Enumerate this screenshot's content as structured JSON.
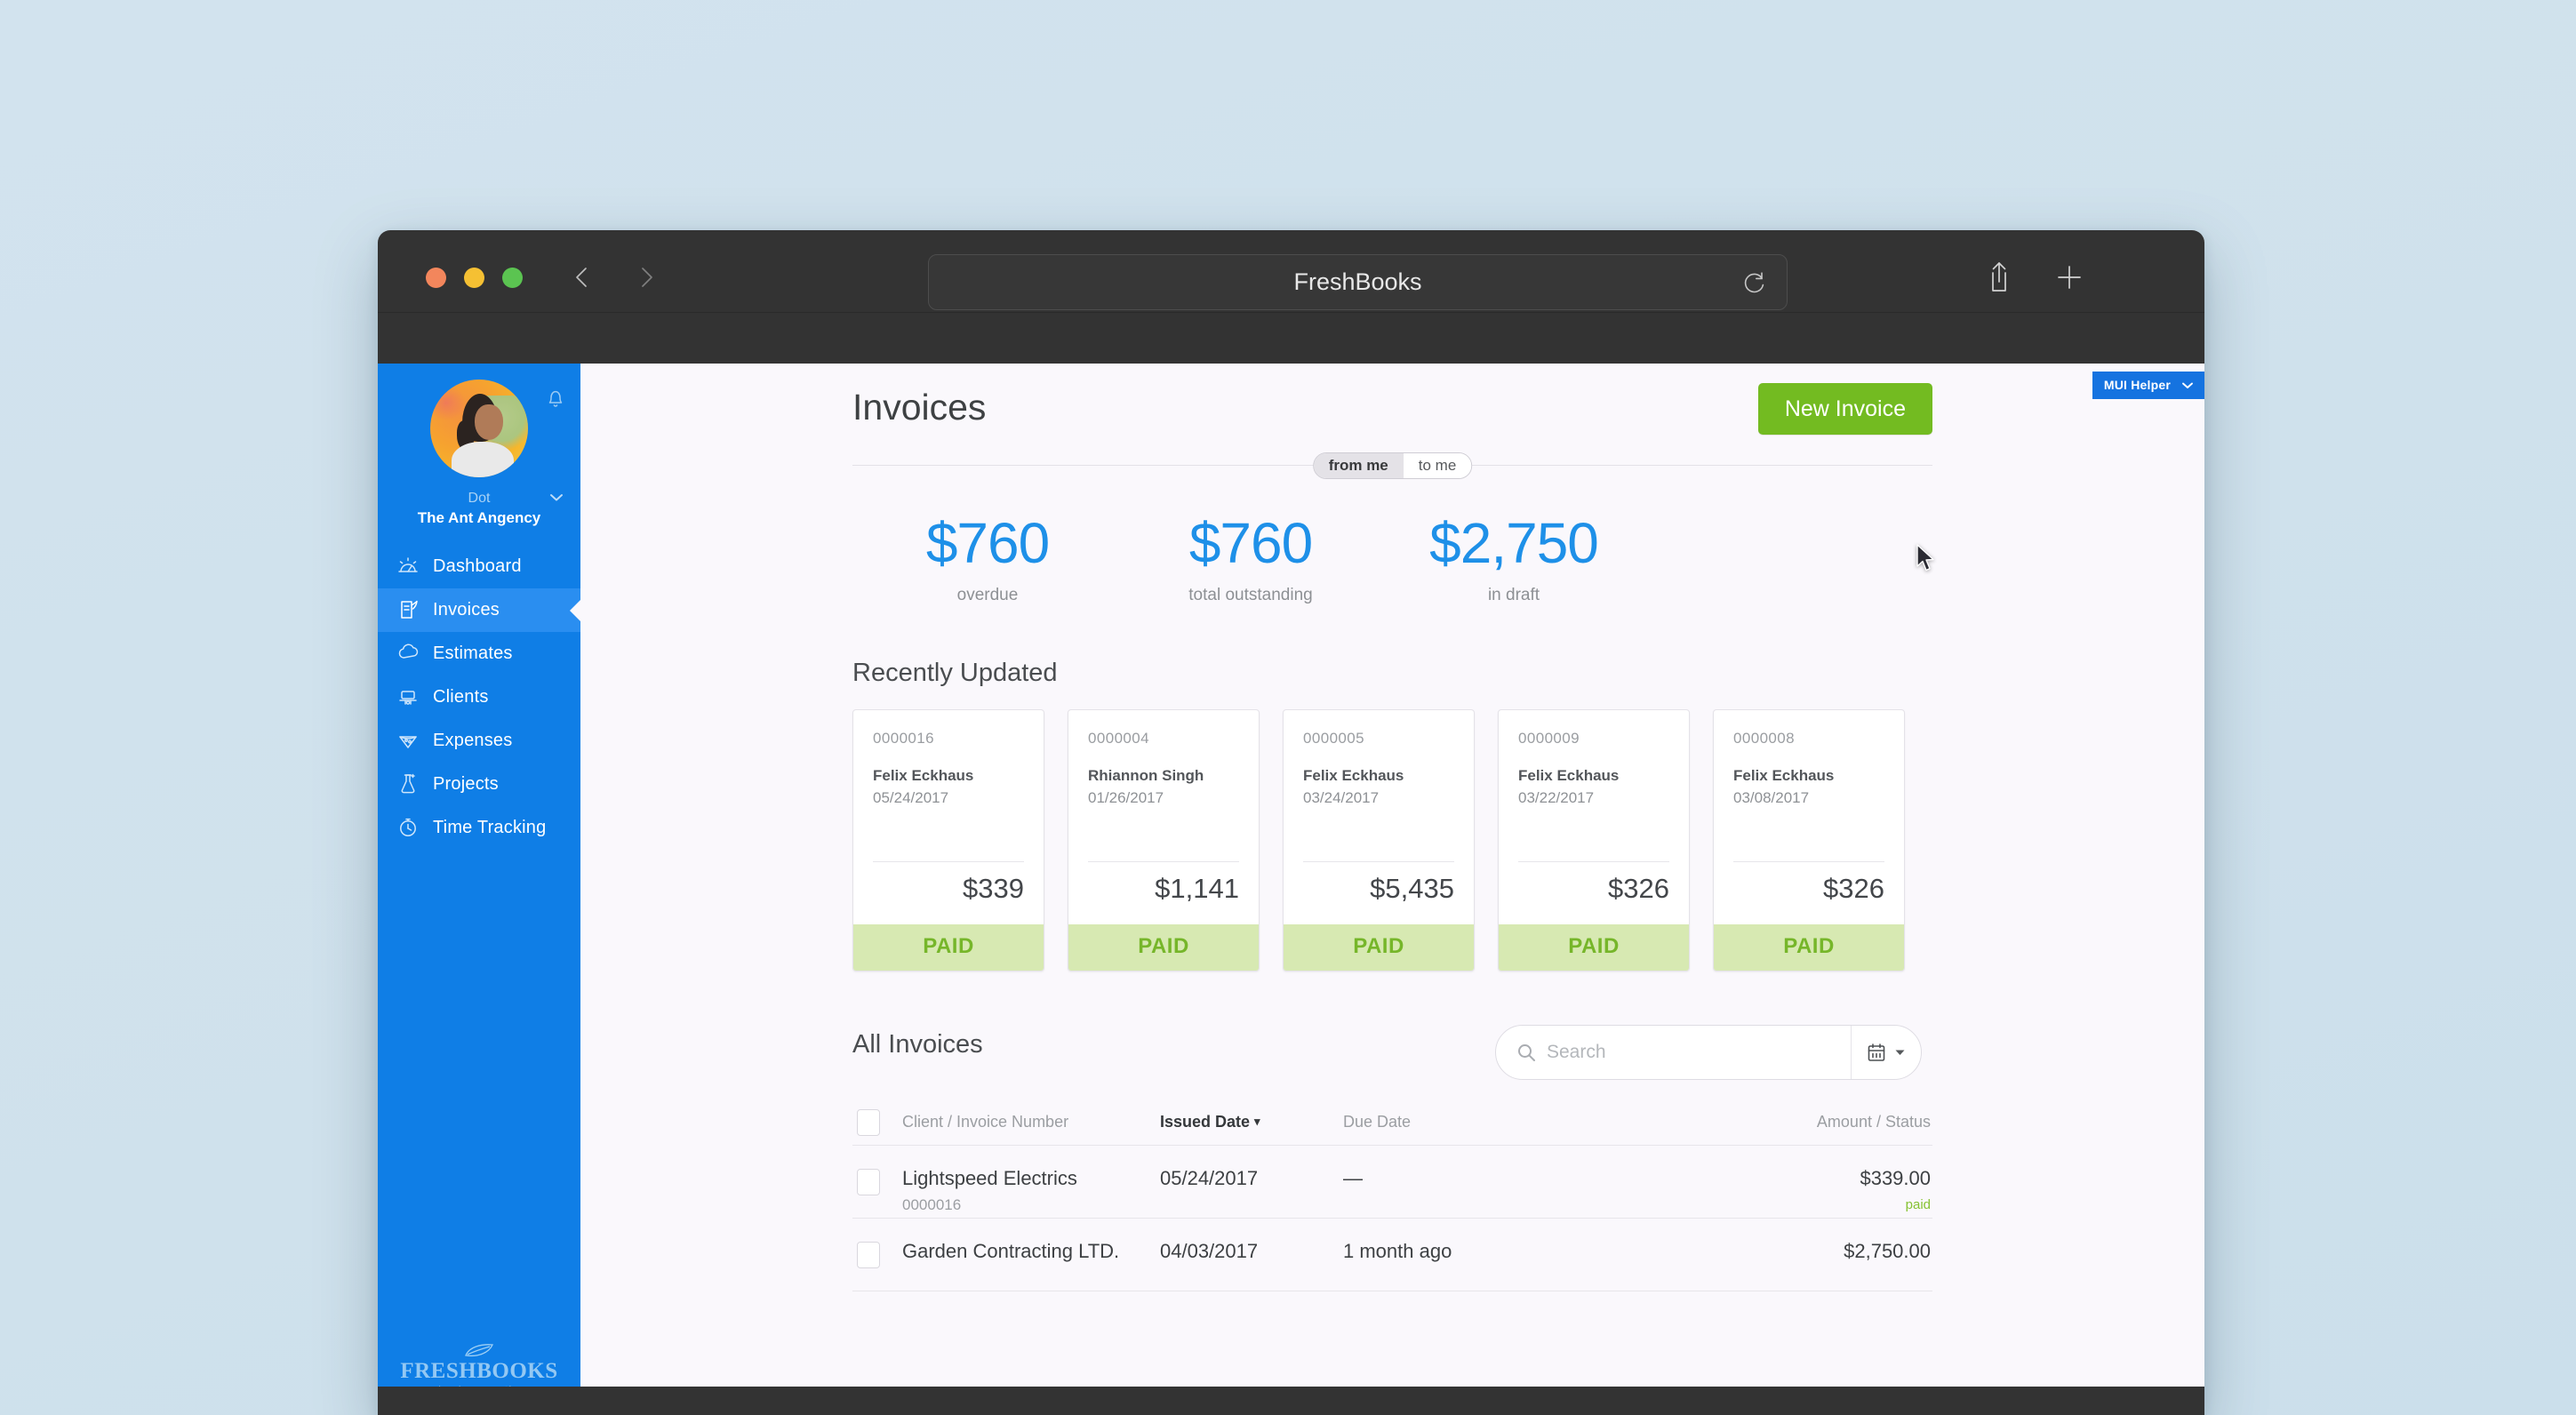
{
  "browser": {
    "title": "FreshBooks",
    "reload_icon": "reload-icon",
    "back_icon": "chevron-left-icon",
    "forward_icon": "chevron-right-icon",
    "share_icon": "share-icon",
    "new_tab_icon": "plus-icon",
    "traffic_lights": [
      "close",
      "minimize",
      "zoom"
    ]
  },
  "sidebar": {
    "profile": {
      "name": "Dot",
      "organization": "The Ant Angency",
      "bell_icon": "bell-icon",
      "caret_icon": "chevron-down-icon",
      "avatar_icon": "avatar"
    },
    "items": [
      {
        "label": "Dashboard",
        "icon": "dashboard-icon",
        "active": false
      },
      {
        "label": "Invoices",
        "icon": "invoice-icon",
        "active": true
      },
      {
        "label": "Estimates",
        "icon": "estimates-icon",
        "active": false
      },
      {
        "label": "Clients",
        "icon": "clients-icon",
        "active": false
      },
      {
        "label": "Expenses",
        "icon": "expenses-icon",
        "active": false
      },
      {
        "label": "Projects",
        "icon": "projects-icon",
        "active": false
      },
      {
        "label": "Time Tracking",
        "icon": "time-tracking-icon",
        "active": false
      }
    ],
    "logo": {
      "name": "FRESHBOOKS",
      "tagline": "cloud accounting",
      "icon": "leaf-icon"
    },
    "background_color": "#0f7ee6",
    "active_color": "#2a8ef0"
  },
  "overlay": {
    "mui_helper_label": "MUI Helper",
    "mui_helper_caret": "chevron-down-icon",
    "mui_helper_color": "#1573e0"
  },
  "main": {
    "page_title": "Invoices",
    "new_invoice_label": "New Invoice",
    "new_invoice_color": "#73bb21",
    "toggle": {
      "options": [
        "from me",
        "to me"
      ],
      "selected": "from me"
    },
    "stats": [
      {
        "value": "$760",
        "label": "overdue"
      },
      {
        "value": "$760",
        "label": "total outstanding"
      },
      {
        "value": "$2,750",
        "label": "in draft"
      }
    ],
    "stat_color": "#1e90e8",
    "recently_updated_title": "Recently Updated",
    "recent_cards": [
      {
        "number": "0000016",
        "client": "Felix Eckhaus",
        "date": "05/24/2017",
        "amount": "$339",
        "status": "PAID"
      },
      {
        "number": "0000004",
        "client": "Rhiannon Singh",
        "date": "01/26/2017",
        "amount": "$1,141",
        "status": "PAID"
      },
      {
        "number": "0000005",
        "client": "Felix Eckhaus",
        "date": "03/24/2017",
        "amount": "$5,435",
        "status": "PAID"
      },
      {
        "number": "0000009",
        "client": "Felix Eckhaus",
        "date": "03/22/2017",
        "amount": "$326",
        "status": "PAID"
      },
      {
        "number": "0000008",
        "client": "Felix Eckhaus",
        "date": "03/08/2017",
        "amount": "$326",
        "status": "PAID"
      }
    ],
    "all_invoices": {
      "title": "All Invoices",
      "search": {
        "placeholder": "Search",
        "value": "",
        "icon": "search-icon"
      },
      "calendar_icon": "calendar-icon",
      "calendar_caret": "caret-down-icon",
      "columns": [
        {
          "label": "Client / Invoice Number",
          "sorted": false
        },
        {
          "label": "Issued Date",
          "sorted": true,
          "caret": "▾"
        },
        {
          "label": "Due Date",
          "sorted": false
        },
        {
          "label": "Amount / Status",
          "sorted": false
        }
      ],
      "rows": [
        {
          "client": "Lightspeed Electrics",
          "invoice_number": "0000016",
          "issued_date": "05/24/2017",
          "due_date": "—",
          "amount": "$339.00",
          "status": "paid"
        },
        {
          "client": "Garden Contracting LTD.",
          "invoice_number": "",
          "issued_date": "04/03/2017",
          "due_date": "1 month ago",
          "amount": "$2,750.00",
          "status": ""
        }
      ]
    }
  }
}
